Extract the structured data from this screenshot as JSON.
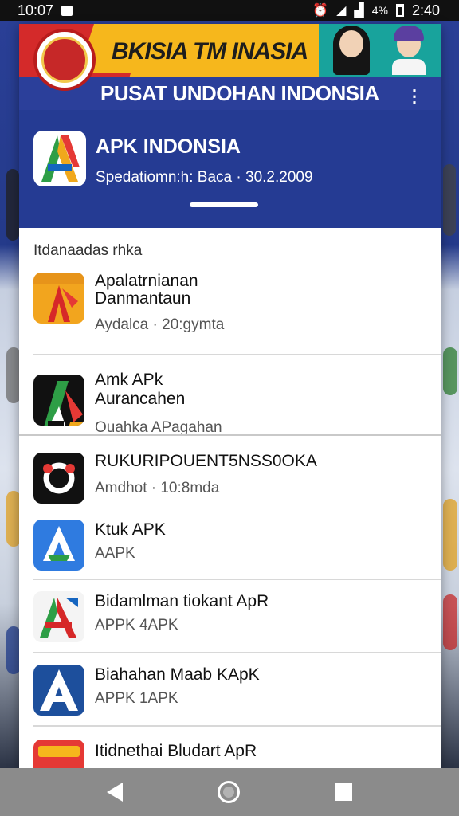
{
  "status_bar": {
    "time_left": "10:07",
    "battery_pct": "4%",
    "time_right": "2:40"
  },
  "banner": {
    "top_text": "BKISIA TM INASIA",
    "bottom_text": "PUSAT UNDOHAN INDONSIA"
  },
  "header": {
    "title": "APK INDONSIA",
    "subtitle": "Spedatiomn:h: Baca · 30.2.2009"
  },
  "section_label": "Itdanaadas rhka",
  "items": [
    {
      "title": "Apalatrnianan",
      "title2": "Danmantaun",
      "sub": "Aydalca · 20:gymta",
      "icon": "apk-orange-icon"
    },
    {
      "title": "Amk APk",
      "title2": "Aurancahen",
      "sub": "Ouahka APagahan",
      "icon": "apk-green-black-icon"
    },
    {
      "title": "RUKURIPOUENT5NSS0OKA",
      "title2": "",
      "sub": "Amdhot · 10:8mda",
      "icon": "apk-red-circle-icon"
    },
    {
      "title": "Ktuk APK",
      "title2": "",
      "sub": "AAPK",
      "icon": "apk-blue-icon"
    },
    {
      "title": "Bidamlman tiokant ApR",
      "title2": "",
      "sub": "APPK 4APK",
      "icon": "apk-red-white-icon"
    },
    {
      "title": "Biahahan Maab KApK",
      "title2": "",
      "sub": "APPK 1APK",
      "icon": "apk-navy-icon"
    },
    {
      "title": "Itidnethai Bludart ApR",
      "title2": "",
      "sub": "",
      "icon": "apk-red-orange-icon"
    }
  ],
  "colors": {
    "header_blue": "#253b93",
    "banner_red": "#d42a2a",
    "banner_yellow": "#f6b71c"
  }
}
